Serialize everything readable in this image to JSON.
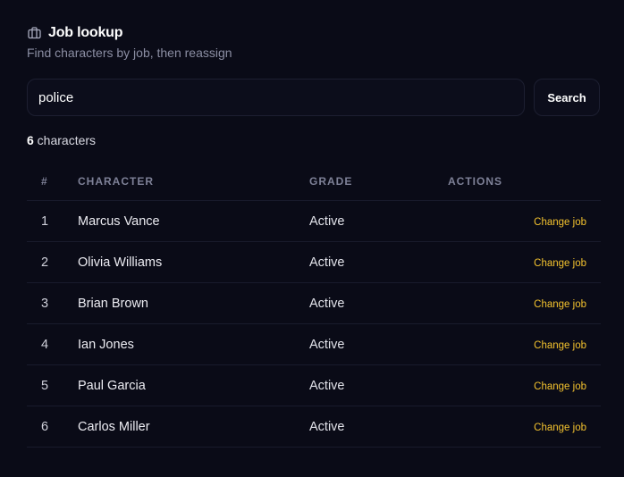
{
  "header": {
    "icon": "briefcase-icon",
    "title": "Job lookup",
    "subtitle": "Find characters by job, then reassign"
  },
  "search": {
    "value": "police",
    "button_label": "Search"
  },
  "results": {
    "count": "6",
    "count_label": " characters"
  },
  "table": {
    "headers": [
      "#",
      "CHARACTER",
      "GRADE",
      "ACTIONS"
    ],
    "rows": [
      {
        "num": "1",
        "name": "Marcus Vance",
        "grade": "Active",
        "action": "Change job"
      },
      {
        "num": "2",
        "name": "Olivia Williams",
        "grade": "Active",
        "action": "Change job"
      },
      {
        "num": "3",
        "name": "Brian Brown",
        "grade": "Active",
        "action": "Change job"
      },
      {
        "num": "4",
        "name": "Ian Jones",
        "grade": "Active",
        "action": "Change job"
      },
      {
        "num": "5",
        "name": "Paul Garcia",
        "grade": "Active",
        "action": "Change job"
      },
      {
        "num": "6",
        "name": "Carlos Miller",
        "grade": "Active",
        "action": "Change job"
      }
    ]
  },
  "colors": {
    "background": "#0a0b17",
    "accent": "#f2c12e",
    "muted": "#8b8ea3",
    "border": "#1d1f31"
  }
}
